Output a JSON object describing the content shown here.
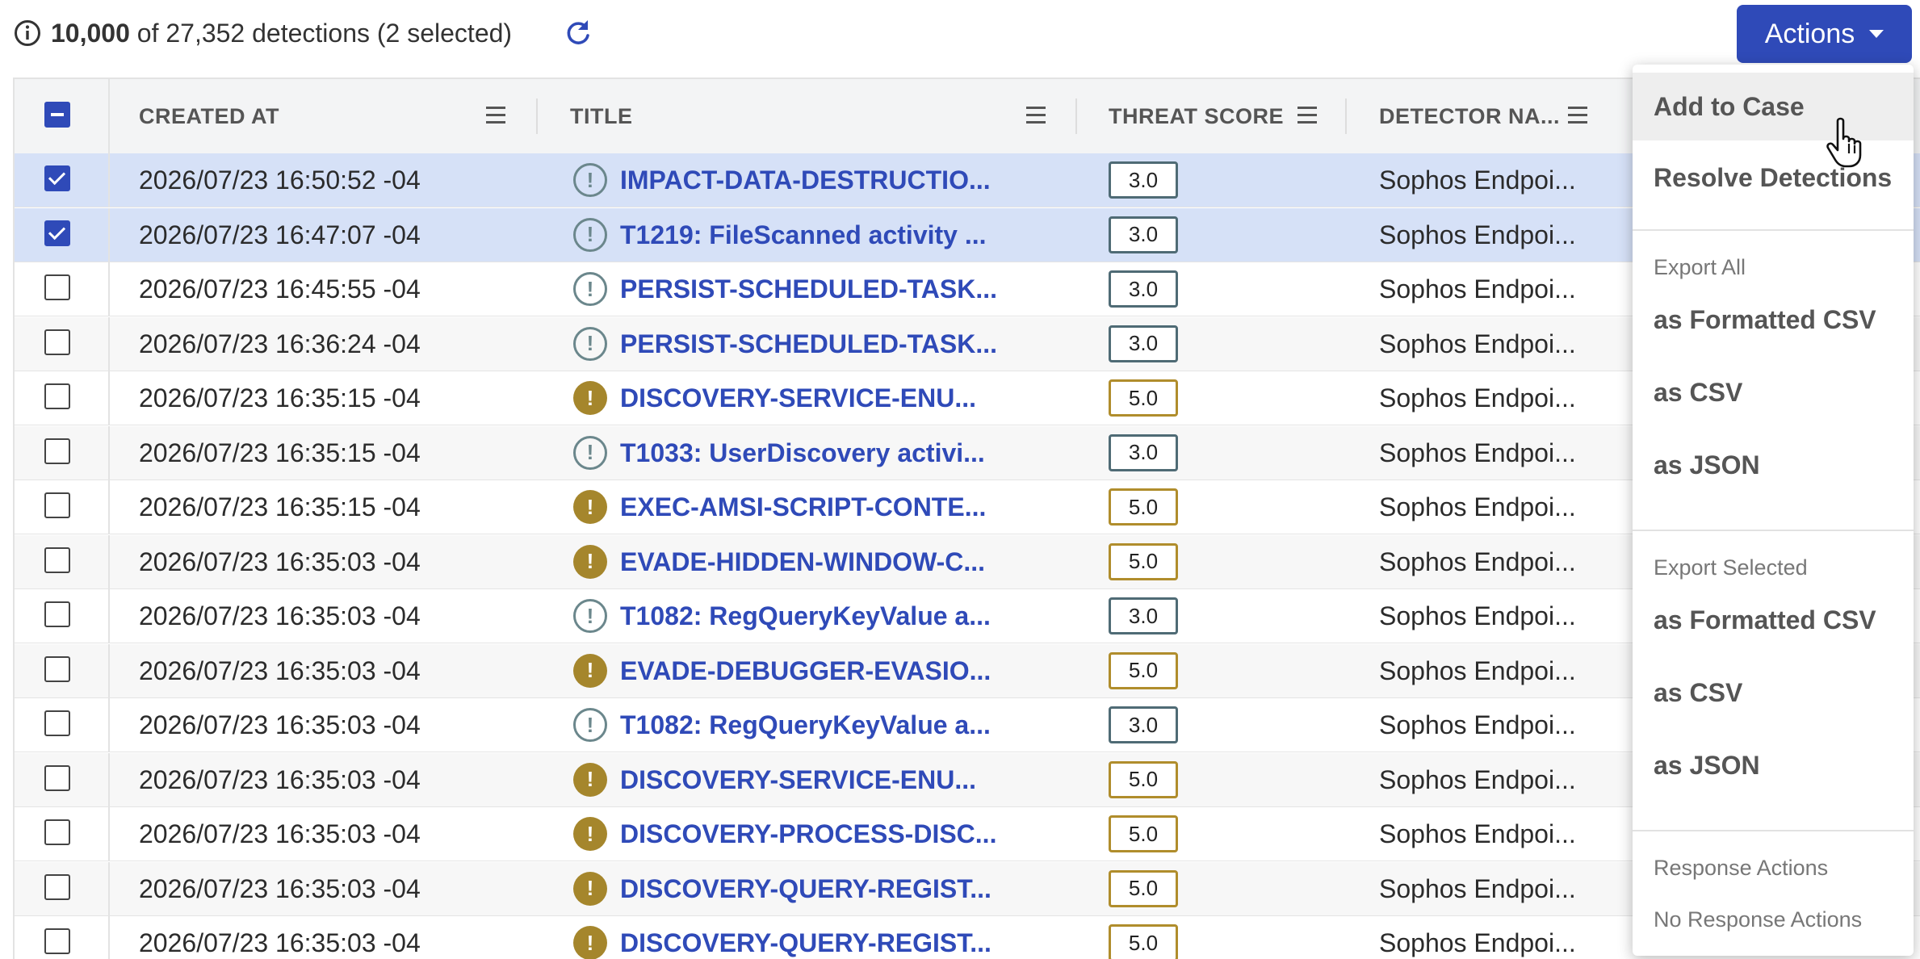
{
  "header": {
    "count_shown": "10,000",
    "count_rest": "of 27,352 detections (2 selected)",
    "actions_label": "Actions"
  },
  "table": {
    "columns": [
      {
        "label": "CREATED AT"
      },
      {
        "label": "TITLE"
      },
      {
        "label": "THREAT SCORE"
      },
      {
        "label": "DETECTOR NA..."
      }
    ],
    "rows": [
      {
        "created": "2026/07/23 16:50:52 -04",
        "severity": "low",
        "title": "IMPACT-DATA-DESTRUCTIO...",
        "score": "3.0",
        "detector": "Sophos Endpoi...",
        "selected": true
      },
      {
        "created": "2026/07/23 16:47:07 -04",
        "severity": "low",
        "title": "T1219: FileScanned activity ...",
        "score": "3.0",
        "detector": "Sophos Endpoi...",
        "selected": true
      },
      {
        "created": "2026/07/23 16:45:55 -04",
        "severity": "low",
        "title": "PERSIST-SCHEDULED-TASK...",
        "score": "3.0",
        "detector": "Sophos Endpoi...",
        "selected": false
      },
      {
        "created": "2026/07/23 16:36:24 -04",
        "severity": "low",
        "title": "PERSIST-SCHEDULED-TASK...",
        "score": "3.0",
        "detector": "Sophos Endpoi...",
        "selected": false
      },
      {
        "created": "2026/07/23 16:35:15 -04",
        "severity": "medium",
        "title": "DISCOVERY-SERVICE-ENU...",
        "score": "5.0",
        "detector": "Sophos Endpoi...",
        "selected": false
      },
      {
        "created": "2026/07/23 16:35:15 -04",
        "severity": "low",
        "title": "T1033: UserDiscovery activi...",
        "score": "3.0",
        "detector": "Sophos Endpoi...",
        "selected": false
      },
      {
        "created": "2026/07/23 16:35:15 -04",
        "severity": "medium",
        "title": "EXEC-AMSI-SCRIPT-CONTE...",
        "score": "5.0",
        "detector": "Sophos Endpoi...",
        "selected": false
      },
      {
        "created": "2026/07/23 16:35:03 -04",
        "severity": "medium",
        "title": "EVADE-HIDDEN-WINDOW-C...",
        "score": "5.0",
        "detector": "Sophos Endpoi...",
        "selected": false
      },
      {
        "created": "2026/07/23 16:35:03 -04",
        "severity": "low",
        "title": "T1082: RegQueryKeyValue a...",
        "score": "3.0",
        "detector": "Sophos Endpoi...",
        "selected": false
      },
      {
        "created": "2026/07/23 16:35:03 -04",
        "severity": "medium",
        "title": "EVADE-DEBUGGER-EVASIO...",
        "score": "5.0",
        "detector": "Sophos Endpoi...",
        "selected": false
      },
      {
        "created": "2026/07/23 16:35:03 -04",
        "severity": "low",
        "title": "T1082: RegQueryKeyValue a...",
        "score": "3.0",
        "detector": "Sophos Endpoi...",
        "selected": false
      },
      {
        "created": "2026/07/23 16:35:03 -04",
        "severity": "medium",
        "title": "DISCOVERY-SERVICE-ENU...",
        "score": "5.0",
        "detector": "Sophos Endpoi...",
        "selected": false
      },
      {
        "created": "2026/07/23 16:35:03 -04",
        "severity": "medium",
        "title": "DISCOVERY-PROCESS-DISC...",
        "score": "5.0",
        "detector": "Sophos Endpoi...",
        "selected": false
      },
      {
        "created": "2026/07/23 16:35:03 -04",
        "severity": "medium",
        "title": "DISCOVERY-QUERY-REGIST...",
        "score": "5.0",
        "detector": "Sophos Endpoi...",
        "selected": false
      },
      {
        "created": "2026/07/23 16:35:03 -04",
        "severity": "medium",
        "title": "DISCOVERY-QUERY-REGIST...",
        "score": "5.0",
        "detector": "Sophos Endpoi...",
        "selected": false
      }
    ]
  },
  "actions_menu": {
    "add_to_case": "Add to Case",
    "resolve": "Resolve Detections",
    "export_all_header": "Export All",
    "export_all_formatted_csv": "as Formatted CSV",
    "export_all_csv": "as CSV",
    "export_all_json": "as JSON",
    "export_selected_header": "Export Selected",
    "export_selected_formatted_csv": "as Formatted CSV",
    "export_selected_csv": "as CSV",
    "export_selected_json": "as JSON",
    "response_header": "Response Actions",
    "no_response": "No Response Actions"
  },
  "colors": {
    "accent": "#2f4ab8",
    "selected_row": "#d6e1f7",
    "severity_low": "#6b878c",
    "severity_medium": "#a5862c"
  },
  "icons": {
    "info": "info-circle-icon",
    "refresh": "refresh-icon",
    "caret": "caret-down-icon",
    "column_menu": "hamburger-menu-icon",
    "severity": "exclamation-circle-icon",
    "cursor": "hand-pointer-cursor-icon"
  }
}
